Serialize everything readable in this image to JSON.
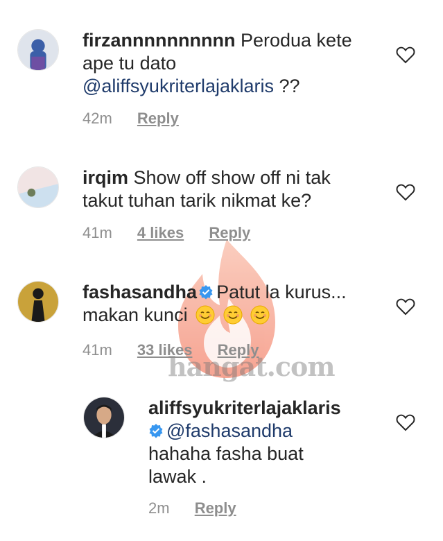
{
  "comments": [
    {
      "username": "firzannnnnnnnnn",
      "line1_rest": "Perodua kete",
      "line2": "ape tu dato",
      "mention": "@aliffsyukriterlajaklaris",
      "mention_suffix": " ??",
      "time": "42m",
      "reply": "Reply"
    },
    {
      "username": "irqim",
      "line1_rest": "Show off show off ni tak",
      "line2": "takut tuhan tarik nikmat ke?",
      "time": "41m",
      "likes": "4 likes",
      "reply": "Reply"
    },
    {
      "username": "fashasandha",
      "line1_rest": "Patut la kurus...",
      "line2": "makan kunci",
      "emojis": [
        "smiling-face-icon",
        "smiling-face-icon",
        "smiling-face-icon"
      ],
      "time": "41m",
      "likes": "33 likes",
      "reply": "Reply"
    },
    {
      "username": "aliffsyukriterlajaklaris",
      "mention": "@fashasandha",
      "line3": "hahaha fasha buat",
      "line4": "lawak .",
      "time": "2m",
      "reply": "Reply"
    }
  ],
  "watermark": {
    "text": "hangat.com",
    "icon": "flame-icon"
  },
  "colors": {
    "mention": "#1f3b6b",
    "meta": "#8e8e8e",
    "verified": "#3897f0",
    "text": "#262626"
  }
}
